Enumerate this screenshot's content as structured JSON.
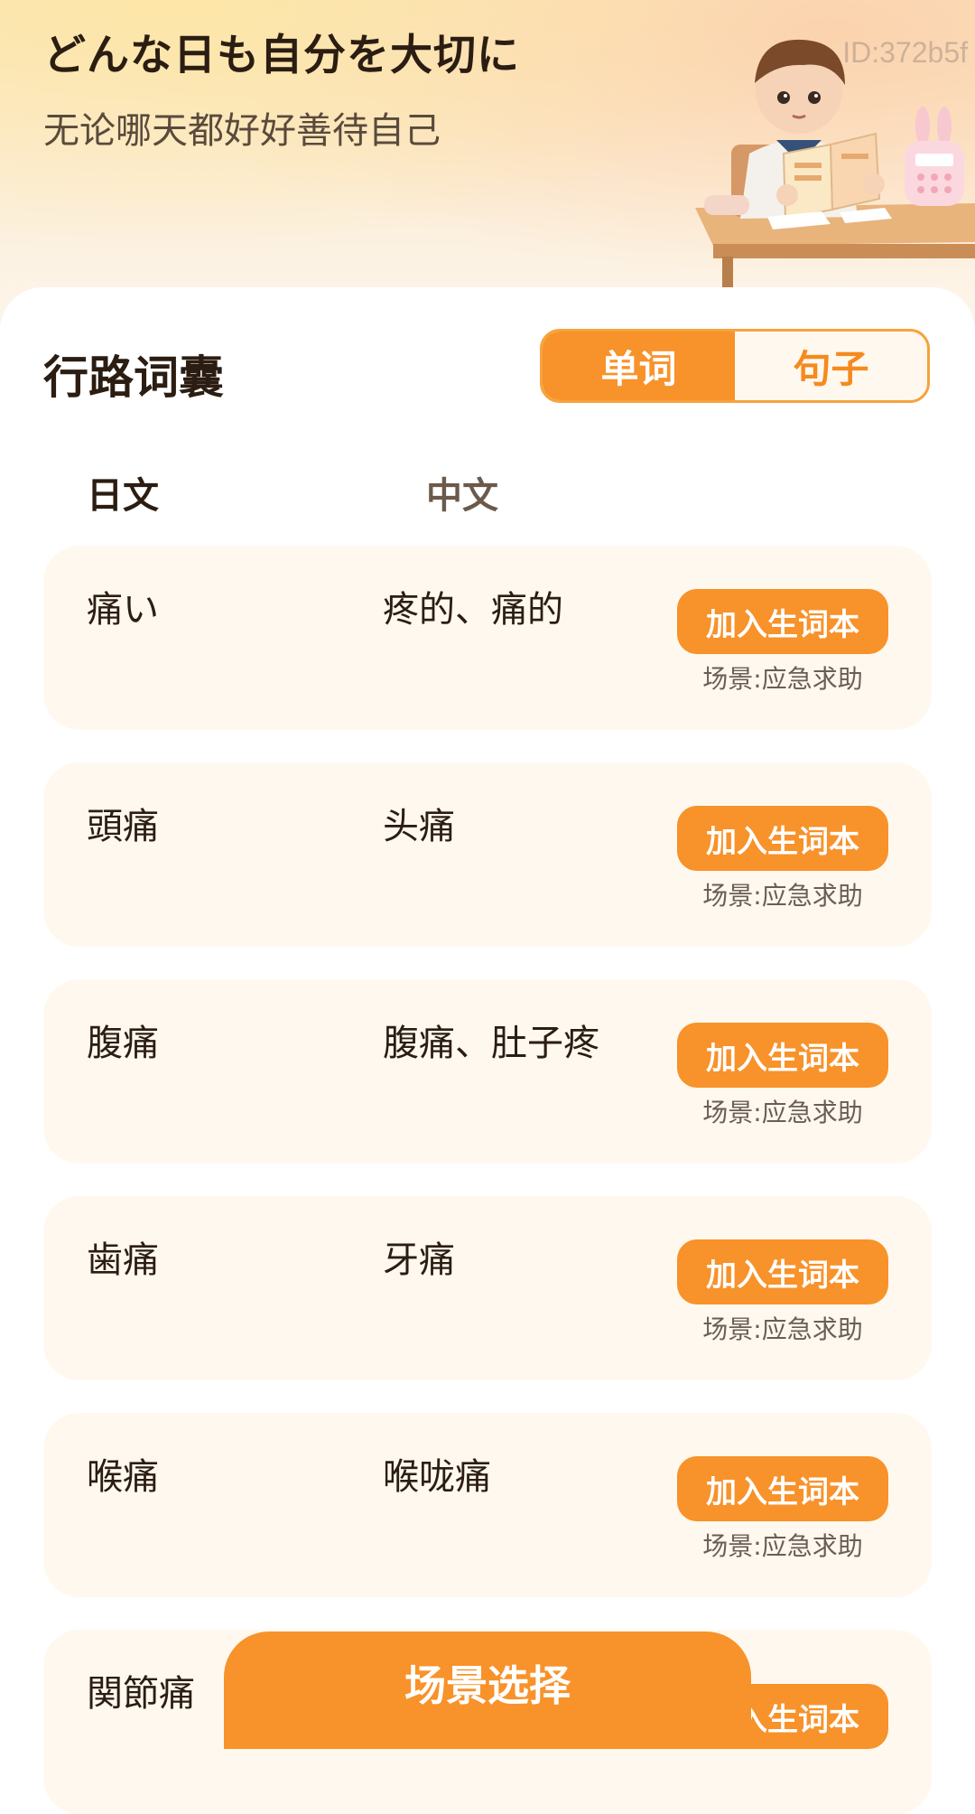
{
  "header": {
    "title": "どんな日も自分を大切に",
    "subtitle": "无论哪天都好好善待自己",
    "id_label": "ID:372b5f"
  },
  "section": {
    "title": "行路词囊",
    "tabs": [
      {
        "label": "单词",
        "active": true
      },
      {
        "label": "句子",
        "active": false
      }
    ]
  },
  "columns": {
    "jp": "日文",
    "cn": "中文"
  },
  "rows": [
    {
      "jp": "痛い",
      "cn": "疼的、痛的",
      "button": "加入生词本",
      "scene": "场景:应急求助"
    },
    {
      "jp": "頭痛",
      "cn": "头痛",
      "button": "加入生词本",
      "scene": "场景:应急求助"
    },
    {
      "jp": "腹痛",
      "cn": "腹痛、肚子疼",
      "button": "加入生词本",
      "scene": "场景:应急求助"
    },
    {
      "jp": "歯痛",
      "cn": "牙痛",
      "button": "加入生词本",
      "scene": "场景:应急求助"
    },
    {
      "jp": "喉痛",
      "cn": "喉咙痛",
      "button": "加入生词本",
      "scene": "场景:应急求助"
    },
    {
      "jp": "関節痛",
      "cn": "",
      "button": "加入生词本",
      "scene": ""
    }
  ],
  "bottom_button": {
    "label": "场景选择"
  },
  "colors": {
    "accent": "#f8922a",
    "row_bg": "#fff8ee",
    "text_dark": "#2b1d12"
  }
}
